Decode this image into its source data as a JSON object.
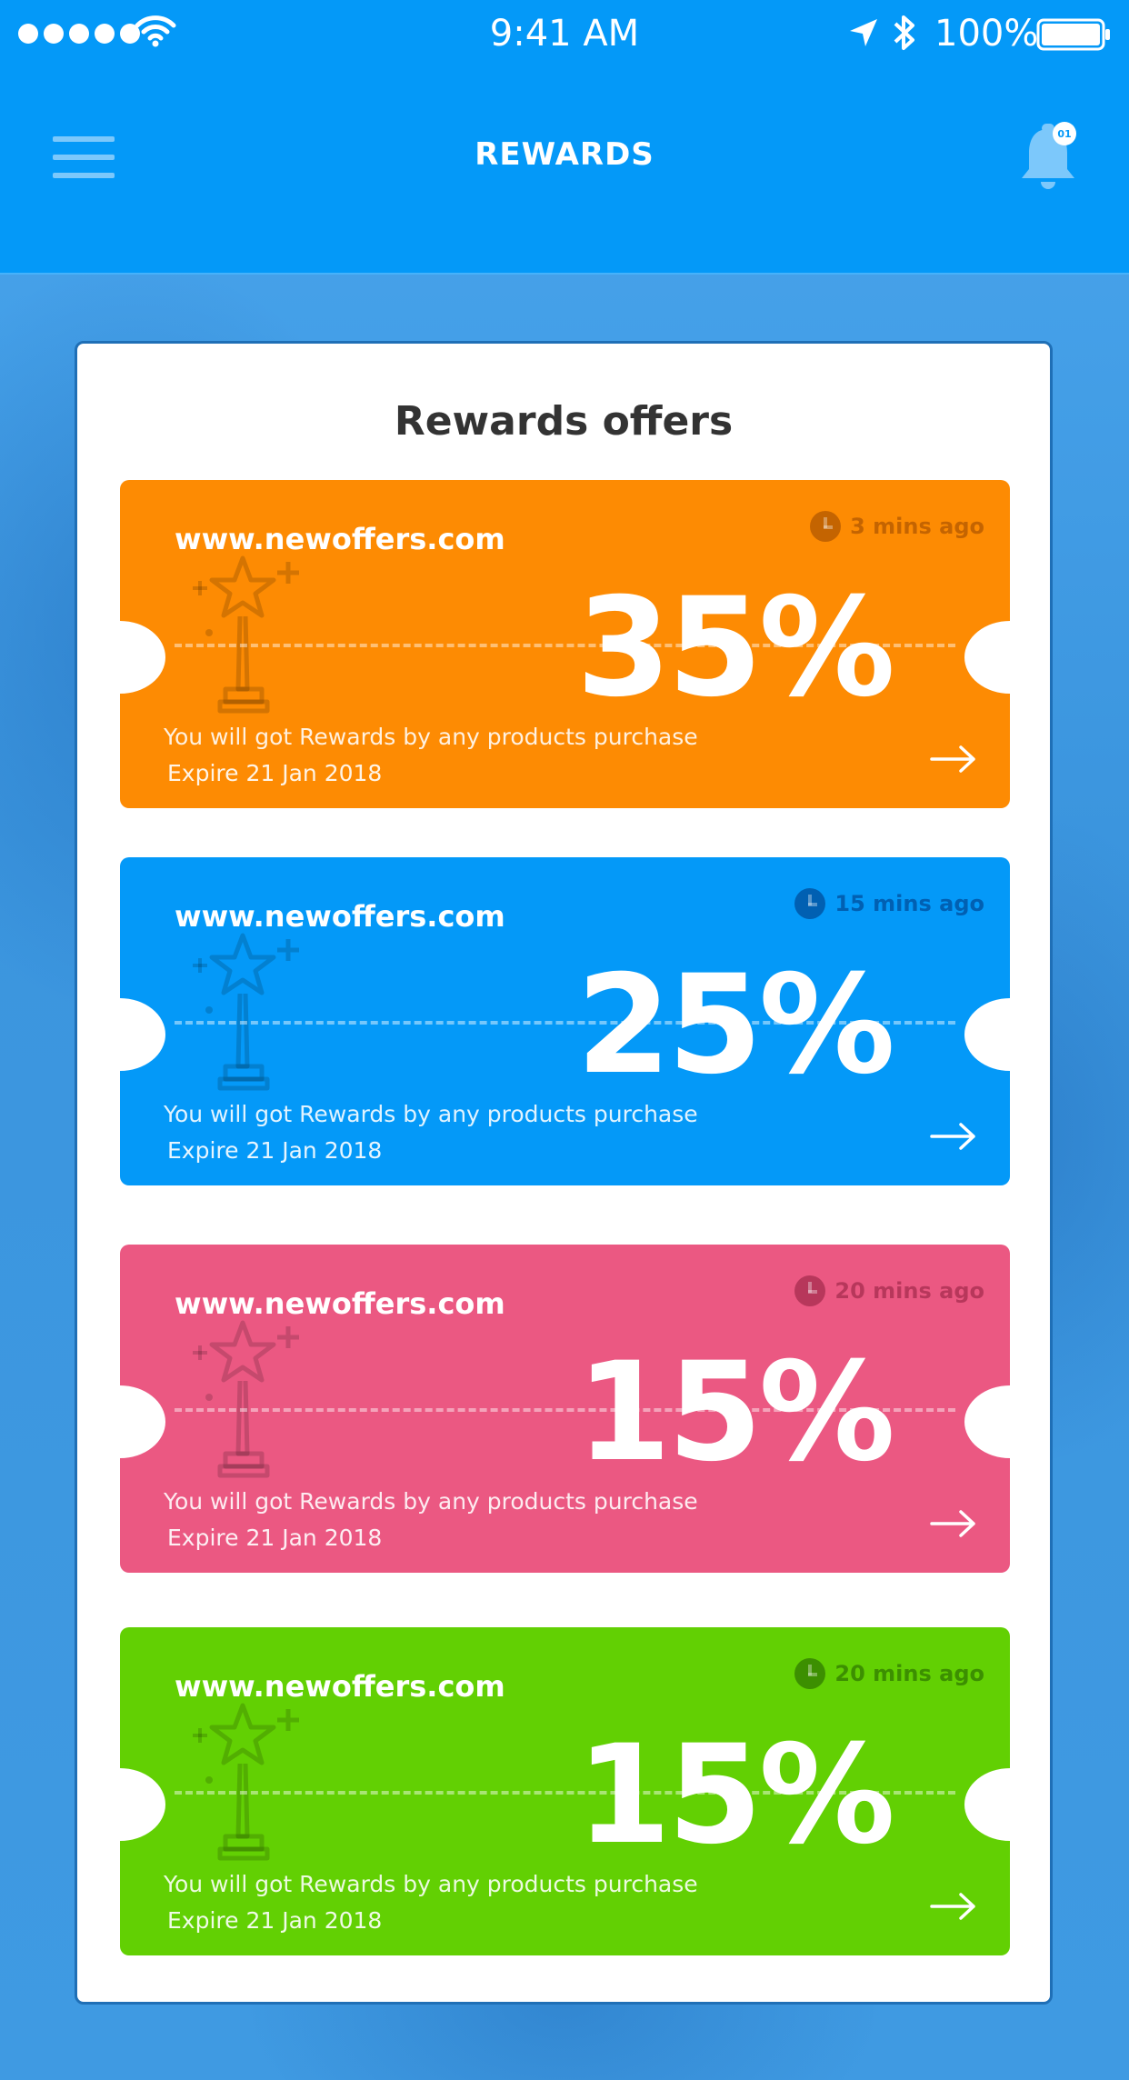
{
  "status_bar": {
    "time": "9:41 AM",
    "battery": "100%"
  },
  "header": {
    "title": "REWARDS",
    "notification_badge": "01"
  },
  "panel": {
    "title": "Rewards offers"
  },
  "offers": [
    {
      "site": "www.newoffers.com",
      "time": "3 mins ago",
      "percent": "35%",
      "description": "You will got Rewards by any products purchase",
      "expire": "Expire 21 Jan 2018",
      "color": "#fd8b03"
    },
    {
      "site": "www.newoffers.com",
      "time": "15 mins ago",
      "percent": "25%",
      "description": "You will got Rewards by any products purchase",
      "expire": "Expire 21 Jan 2018",
      "color": "#0499f8"
    },
    {
      "site": "www.newoffers.com",
      "time": "20 mins ago",
      "percent": "15%",
      "description": "You will got Rewards by any products purchase",
      "expire": "Expire 21 Jan 2018",
      "color": "#eb5882"
    },
    {
      "site": "www.newoffers.com",
      "time": "20 mins ago",
      "percent": "15%",
      "description": "You will got Rewards by any products purchase",
      "expire": "Expire 21 Jan 2018",
      "color": "#62d003"
    }
  ],
  "icons": {
    "menu": "hamburger-icon",
    "notifications": "bell-icon",
    "ticket_time": "clock-icon",
    "ticket_action": "arrow-right-icon",
    "ticket_watermark": "trophy-icon"
  }
}
